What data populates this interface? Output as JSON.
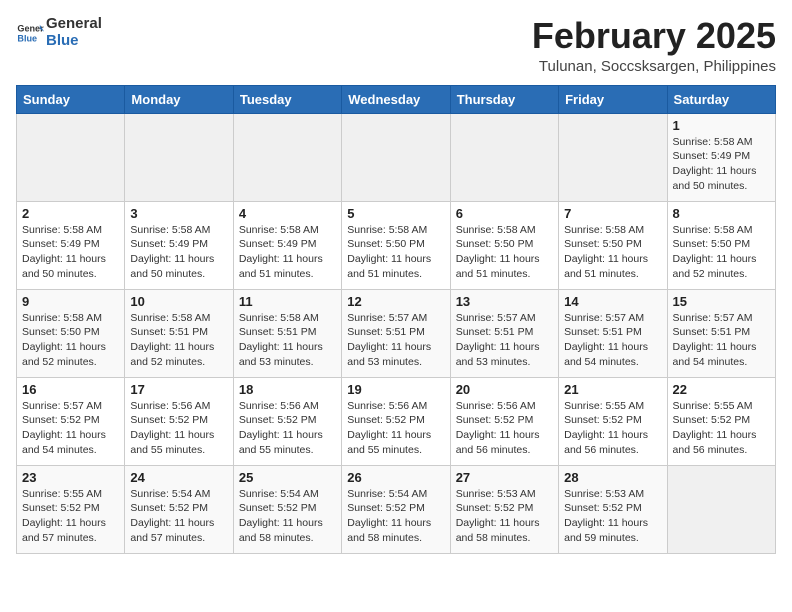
{
  "header": {
    "logo_line1": "General",
    "logo_line2": "Blue",
    "month_year": "February 2025",
    "location": "Tulunan, Soccsksargen, Philippines"
  },
  "weekdays": [
    "Sunday",
    "Monday",
    "Tuesday",
    "Wednesday",
    "Thursday",
    "Friday",
    "Saturday"
  ],
  "weeks": [
    [
      {
        "day": "",
        "detail": ""
      },
      {
        "day": "",
        "detail": ""
      },
      {
        "day": "",
        "detail": ""
      },
      {
        "day": "",
        "detail": ""
      },
      {
        "day": "",
        "detail": ""
      },
      {
        "day": "",
        "detail": ""
      },
      {
        "day": "1",
        "detail": "Sunrise: 5:58 AM\nSunset: 5:49 PM\nDaylight: 11 hours\nand 50 minutes."
      }
    ],
    [
      {
        "day": "2",
        "detail": "Sunrise: 5:58 AM\nSunset: 5:49 PM\nDaylight: 11 hours\nand 50 minutes."
      },
      {
        "day": "3",
        "detail": "Sunrise: 5:58 AM\nSunset: 5:49 PM\nDaylight: 11 hours\nand 50 minutes."
      },
      {
        "day": "4",
        "detail": "Sunrise: 5:58 AM\nSunset: 5:49 PM\nDaylight: 11 hours\nand 51 minutes."
      },
      {
        "day": "5",
        "detail": "Sunrise: 5:58 AM\nSunset: 5:50 PM\nDaylight: 11 hours\nand 51 minutes."
      },
      {
        "day": "6",
        "detail": "Sunrise: 5:58 AM\nSunset: 5:50 PM\nDaylight: 11 hours\nand 51 minutes."
      },
      {
        "day": "7",
        "detail": "Sunrise: 5:58 AM\nSunset: 5:50 PM\nDaylight: 11 hours\nand 51 minutes."
      },
      {
        "day": "8",
        "detail": "Sunrise: 5:58 AM\nSunset: 5:50 PM\nDaylight: 11 hours\nand 52 minutes."
      }
    ],
    [
      {
        "day": "9",
        "detail": "Sunrise: 5:58 AM\nSunset: 5:50 PM\nDaylight: 11 hours\nand 52 minutes."
      },
      {
        "day": "10",
        "detail": "Sunrise: 5:58 AM\nSunset: 5:51 PM\nDaylight: 11 hours\nand 52 minutes."
      },
      {
        "day": "11",
        "detail": "Sunrise: 5:58 AM\nSunset: 5:51 PM\nDaylight: 11 hours\nand 53 minutes."
      },
      {
        "day": "12",
        "detail": "Sunrise: 5:57 AM\nSunset: 5:51 PM\nDaylight: 11 hours\nand 53 minutes."
      },
      {
        "day": "13",
        "detail": "Sunrise: 5:57 AM\nSunset: 5:51 PM\nDaylight: 11 hours\nand 53 minutes."
      },
      {
        "day": "14",
        "detail": "Sunrise: 5:57 AM\nSunset: 5:51 PM\nDaylight: 11 hours\nand 54 minutes."
      },
      {
        "day": "15",
        "detail": "Sunrise: 5:57 AM\nSunset: 5:51 PM\nDaylight: 11 hours\nand 54 minutes."
      }
    ],
    [
      {
        "day": "16",
        "detail": "Sunrise: 5:57 AM\nSunset: 5:52 PM\nDaylight: 11 hours\nand 54 minutes."
      },
      {
        "day": "17",
        "detail": "Sunrise: 5:56 AM\nSunset: 5:52 PM\nDaylight: 11 hours\nand 55 minutes."
      },
      {
        "day": "18",
        "detail": "Sunrise: 5:56 AM\nSunset: 5:52 PM\nDaylight: 11 hours\nand 55 minutes."
      },
      {
        "day": "19",
        "detail": "Sunrise: 5:56 AM\nSunset: 5:52 PM\nDaylight: 11 hours\nand 55 minutes."
      },
      {
        "day": "20",
        "detail": "Sunrise: 5:56 AM\nSunset: 5:52 PM\nDaylight: 11 hours\nand 56 minutes."
      },
      {
        "day": "21",
        "detail": "Sunrise: 5:55 AM\nSunset: 5:52 PM\nDaylight: 11 hours\nand 56 minutes."
      },
      {
        "day": "22",
        "detail": "Sunrise: 5:55 AM\nSunset: 5:52 PM\nDaylight: 11 hours\nand 56 minutes."
      }
    ],
    [
      {
        "day": "23",
        "detail": "Sunrise: 5:55 AM\nSunset: 5:52 PM\nDaylight: 11 hours\nand 57 minutes."
      },
      {
        "day": "24",
        "detail": "Sunrise: 5:54 AM\nSunset: 5:52 PM\nDaylight: 11 hours\nand 57 minutes."
      },
      {
        "day": "25",
        "detail": "Sunrise: 5:54 AM\nSunset: 5:52 PM\nDaylight: 11 hours\nand 58 minutes."
      },
      {
        "day": "26",
        "detail": "Sunrise: 5:54 AM\nSunset: 5:52 PM\nDaylight: 11 hours\nand 58 minutes."
      },
      {
        "day": "27",
        "detail": "Sunrise: 5:53 AM\nSunset: 5:52 PM\nDaylight: 11 hours\nand 58 minutes."
      },
      {
        "day": "28",
        "detail": "Sunrise: 5:53 AM\nSunset: 5:52 PM\nDaylight: 11 hours\nand 59 minutes."
      },
      {
        "day": "",
        "detail": ""
      }
    ]
  ]
}
